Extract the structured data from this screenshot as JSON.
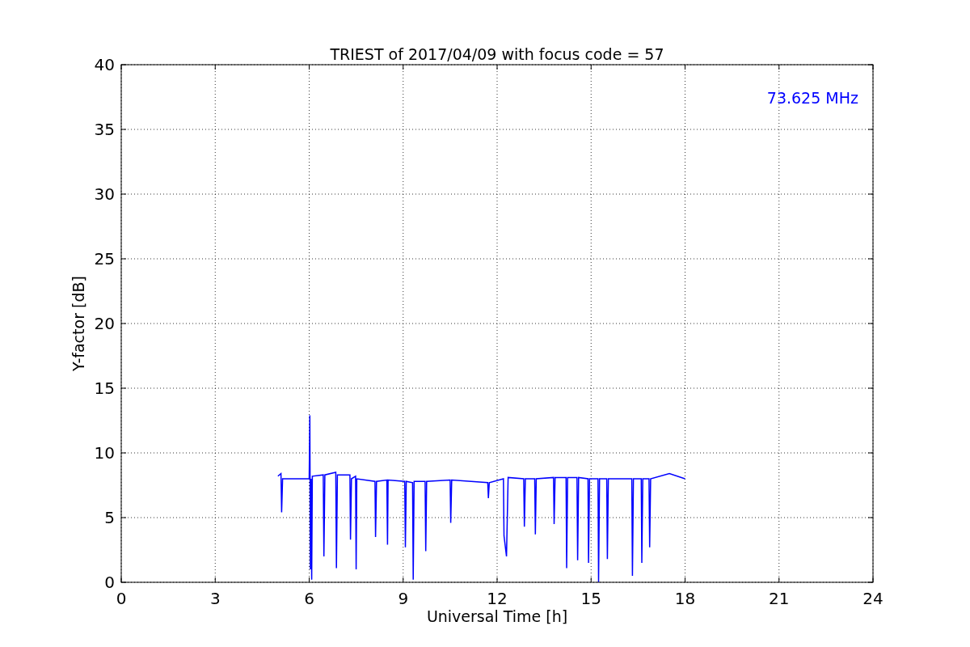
{
  "chart_data": {
    "type": "line",
    "title": "TRIEST of 2017/04/09 with focus code = 57",
    "xlabel": "Universal Time [h]",
    "ylabel": "Y-factor [dB]",
    "xlim": [
      0,
      24
    ],
    "ylim": [
      0,
      40
    ],
    "xticks": [
      0,
      3,
      6,
      9,
      12,
      15,
      18,
      21,
      24
    ],
    "yticks": [
      0,
      5,
      10,
      15,
      20,
      25,
      30,
      35,
      40
    ],
    "grid": true,
    "x": [
      5.0,
      5.1,
      5.12,
      5.15,
      6.0,
      6.02,
      6.04,
      6.06,
      6.08,
      6.1,
      6.45,
      6.47,
      6.5,
      6.85,
      6.87,
      6.9,
      7.3,
      7.32,
      7.35,
      7.48,
      7.5,
      7.52,
      8.1,
      8.12,
      8.15,
      8.48,
      8.5,
      8.52,
      9.05,
      9.07,
      9.1,
      9.3,
      9.32,
      9.35,
      9.7,
      9.72,
      9.75,
      10.5,
      10.52,
      10.55,
      11.7,
      11.72,
      11.75,
      12.2,
      12.22,
      12.3,
      12.35,
      12.85,
      12.87,
      12.9,
      13.2,
      13.22,
      13.25,
      13.8,
      13.82,
      13.85,
      14.2,
      14.22,
      14.25,
      14.55,
      14.57,
      14.6,
      14.9,
      14.92,
      14.95,
      15.22,
      15.24,
      15.27,
      15.5,
      15.52,
      15.55,
      16.3,
      16.32,
      16.35,
      16.6,
      16.62,
      16.65,
      16.85,
      16.87,
      16.9,
      17.5,
      18.0
    ],
    "series": [
      {
        "name": "73.625 MHz",
        "color": "#0000ff",
        "values": [
          8.2,
          8.4,
          5.4,
          8.0,
          8.0,
          12.9,
          1.0,
          8.0,
          0.2,
          8.2,
          8.3,
          2.0,
          8.3,
          8.5,
          1.1,
          8.3,
          8.3,
          3.3,
          8.0,
          8.2,
          1.0,
          8.0,
          7.8,
          3.5,
          7.8,
          7.9,
          2.9,
          7.9,
          7.8,
          2.7,
          7.8,
          7.7,
          0.2,
          7.8,
          7.8,
          2.4,
          7.8,
          7.9,
          4.6,
          7.9,
          7.7,
          6.5,
          7.7,
          8.0,
          3.6,
          2.0,
          8.1,
          8.0,
          4.3,
          8.0,
          8.0,
          3.7,
          8.0,
          8.1,
          4.5,
          8.1,
          8.1,
          1.1,
          8.1,
          8.1,
          1.7,
          8.1,
          8.0,
          1.5,
          8.0,
          8.0,
          0.0,
          8.0,
          8.0,
          1.8,
          8.0,
          8.0,
          0.5,
          8.0,
          8.0,
          1.5,
          8.0,
          8.0,
          2.7,
          8.0,
          8.4,
          8.0
        ]
      }
    ]
  }
}
